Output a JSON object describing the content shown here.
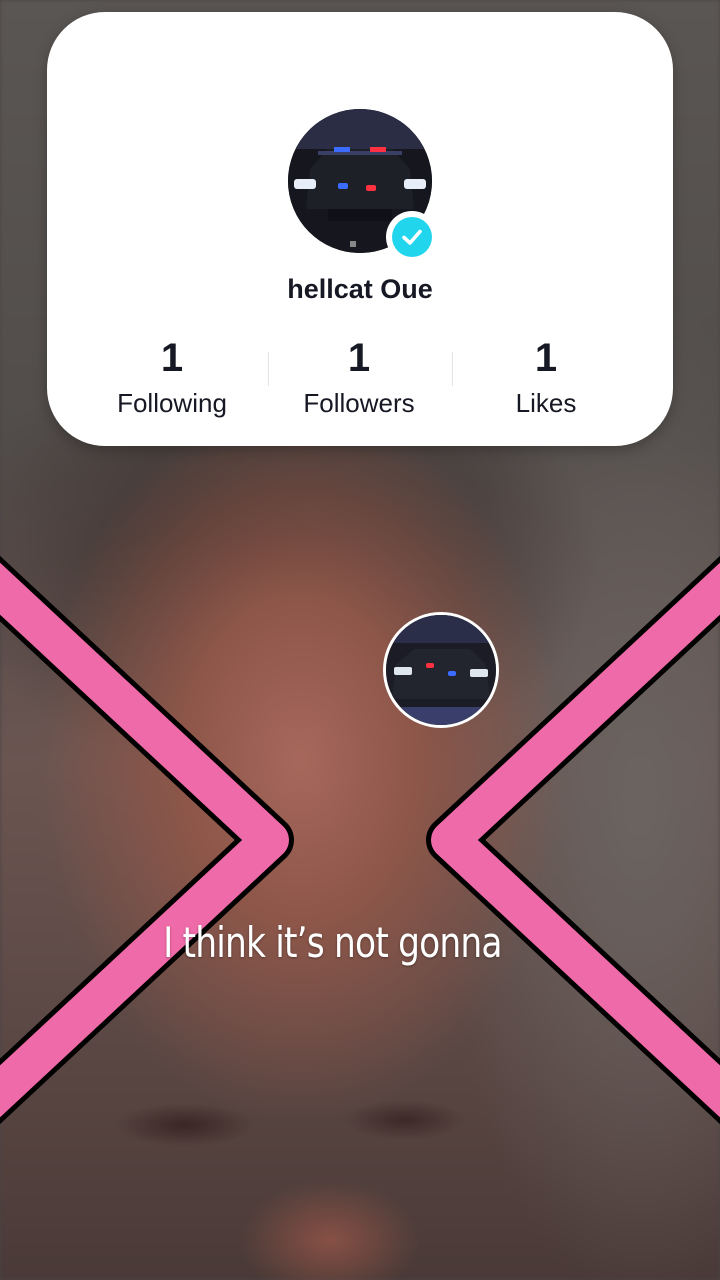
{
  "profile": {
    "username": "hellcat Oue",
    "verified": true,
    "stats": [
      {
        "value": "1",
        "label": "Following"
      },
      {
        "value": "1",
        "label": "Followers"
      },
      {
        "value": "1",
        "label": "Likes"
      }
    ]
  },
  "caption": "I think it’s not gonna",
  "colors": {
    "verified_badge": "#20d5ec",
    "x_overlay": "#ef6aa8",
    "card": "#ffffff"
  }
}
